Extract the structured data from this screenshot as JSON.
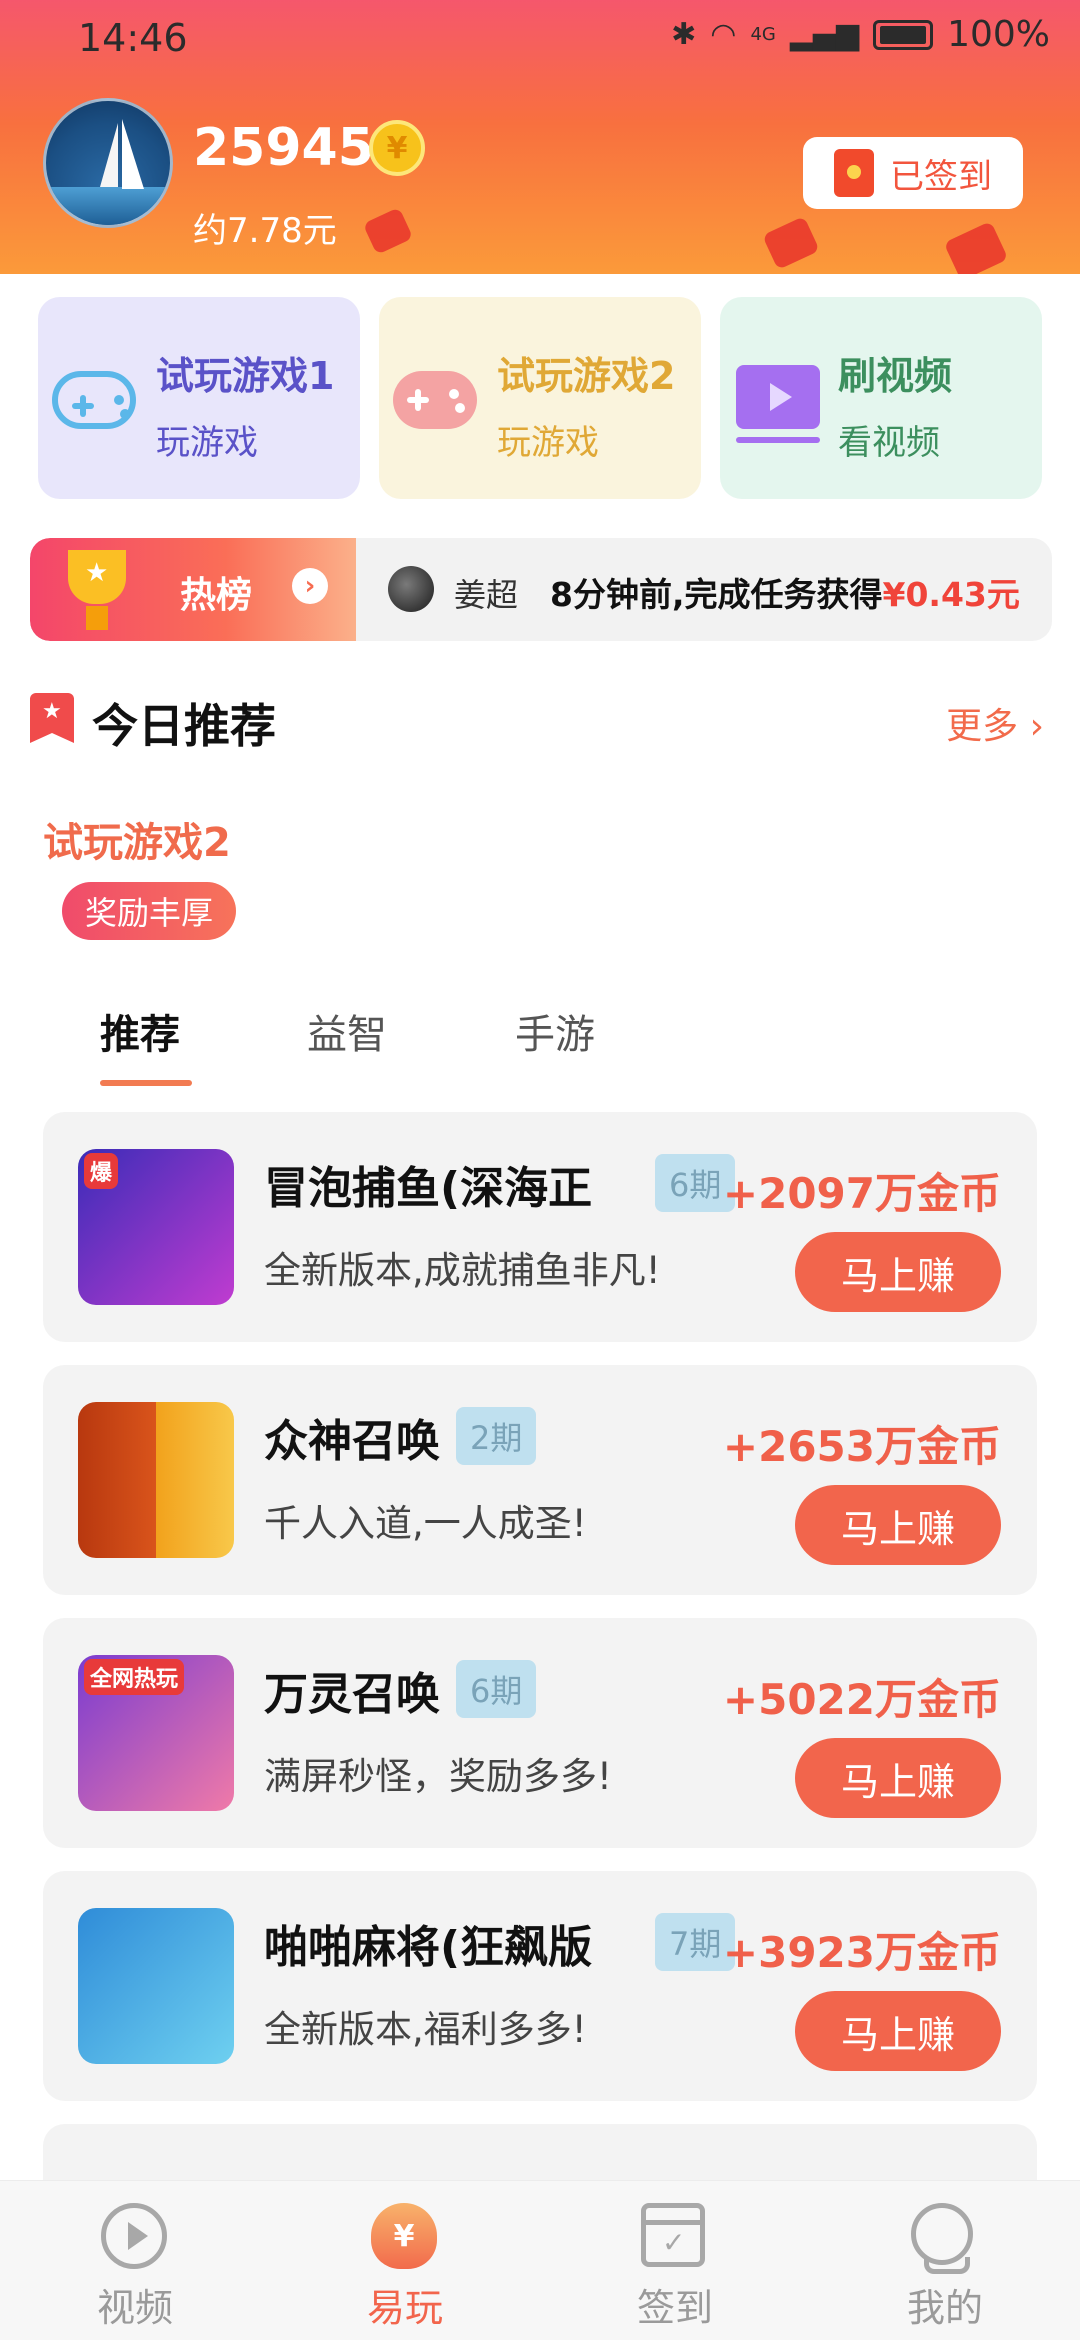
{
  "status_bar": {
    "time": "14:46",
    "network": "4G",
    "battery": "100%"
  },
  "header": {
    "coins": "25945",
    "coin_symbol": "¥",
    "cash_estimate": "约7.78元",
    "sign_label": "已签到"
  },
  "quick_cards": [
    {
      "title": "试玩游戏1",
      "subtitle": "玩游戏",
      "icon": "gamepad-icon",
      "bg": "#e8e6fb",
      "title_color": "#5a52c8",
      "icon_color": "#5bb7e9"
    },
    {
      "title": "试玩游戏2",
      "subtitle": "玩游戏",
      "icon": "gamepad-icon",
      "bg": "#faf4dd",
      "title_color": "#e0a836",
      "icon_color": "#f08a8a"
    },
    {
      "title": "刷视频",
      "subtitle": "看视频",
      "icon": "video-icon",
      "bg": "#e4f6ee",
      "title_color": "#3c8f5e",
      "icon_color": "#a56ff0"
    }
  ],
  "ticker": {
    "label": "热榜",
    "user": "姜超",
    "message": "8分钟前,完成任务获得",
    "amount": "¥0.43元"
  },
  "section": {
    "title": "今日推荐",
    "more": "更多",
    "promo_title": "试玩游戏2",
    "promo_badge": "奖励丰厚"
  },
  "tabs": [
    "推荐",
    "益智",
    "手游"
  ],
  "games": [
    {
      "name": "冒泡捕鱼(深海正",
      "period": "6期",
      "desc": "全新版本,成就捕鱼非凡!",
      "reward": "+2097万金币",
      "button": "马上赚",
      "thumb_label": "爆",
      "thumb_colors": [
        "#3b2cb8",
        "#c03cd0"
      ]
    },
    {
      "name": "众神召唤",
      "period": "2期",
      "desc": "千人入道,一人成圣!",
      "reward": "+2653万金币",
      "button": "马上赚",
      "thumb_label": "",
      "thumb_colors": [
        "#b8380f",
        "#f2a21c"
      ]
    },
    {
      "name": "万灵召唤",
      "period": "6期",
      "desc": "满屏秒怪，奖励多多!",
      "reward": "+5022万金币",
      "button": "马上赚",
      "thumb_label": "全网热玩",
      "thumb_colors": [
        "#7a3cd0",
        "#f07aa8"
      ]
    },
    {
      "name": "啪啪麻将(狂飙版",
      "period": "7期",
      "desc": "全新版本,福利多多!",
      "reward": "+3923万金币",
      "button": "马上赚",
      "thumb_label": "",
      "thumb_colors": [
        "#2f8cd8",
        "#6ed0f0"
      ]
    }
  ],
  "bottom_nav": [
    {
      "label": "视频",
      "icon": "play-icon",
      "active": false
    },
    {
      "label": "易玩",
      "icon": "money-bag-icon",
      "active": true
    },
    {
      "label": "签到",
      "icon": "calendar-icon",
      "active": false
    },
    {
      "label": "我的",
      "icon": "user-icon",
      "active": false
    }
  ],
  "colors": {
    "accent": "#f2654c",
    "header_top": "#f5576c",
    "header_bottom": "#fb9a3a"
  }
}
